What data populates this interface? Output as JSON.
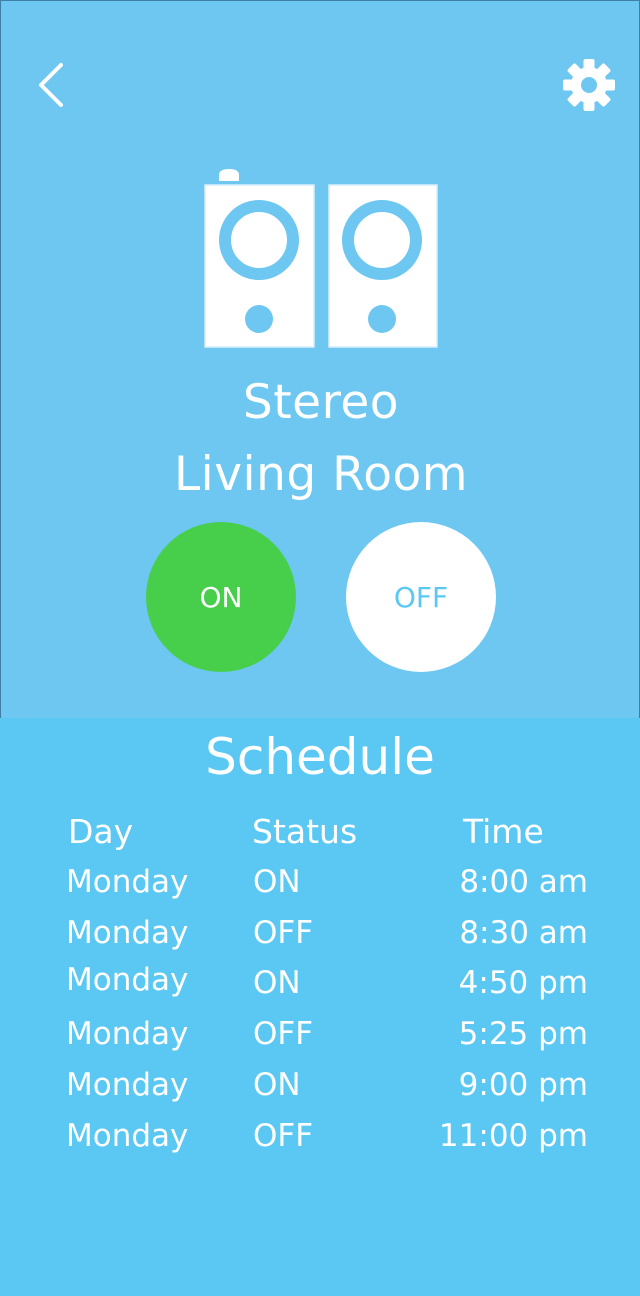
{
  "header": {
    "back_icon": "chevron-left-icon",
    "settings_icon": "gear-icon"
  },
  "device": {
    "icon": "speakers-icon",
    "type": "Stereo",
    "room": "Living Room"
  },
  "power": {
    "on_label": "ON",
    "off_label": "OFF",
    "state": "ON",
    "colors": {
      "on_bg": "#47cf4b",
      "off_bg": "#ffffff",
      "panel_bg": "#6dc7f1",
      "schedule_bg": "#5ac8f3"
    }
  },
  "schedule": {
    "title": "Schedule",
    "columns": [
      "Day",
      "Status",
      "Time"
    ],
    "rows": [
      {
        "day": "Monday",
        "status": "ON",
        "time": "8:00 am"
      },
      {
        "day": "Monday",
        "status": "OFF",
        "time": "8:30 am"
      },
      {
        "day": "Monday",
        "status": "ON",
        "time": "4:50 pm"
      },
      {
        "day": "Monday",
        "status": "OFF",
        "time": "5:25 pm"
      },
      {
        "day": "Monday",
        "status": "ON",
        "time": "9:00 pm"
      },
      {
        "day": "Monday",
        "status": "OFF",
        "time": "11:00 pm"
      }
    ]
  }
}
